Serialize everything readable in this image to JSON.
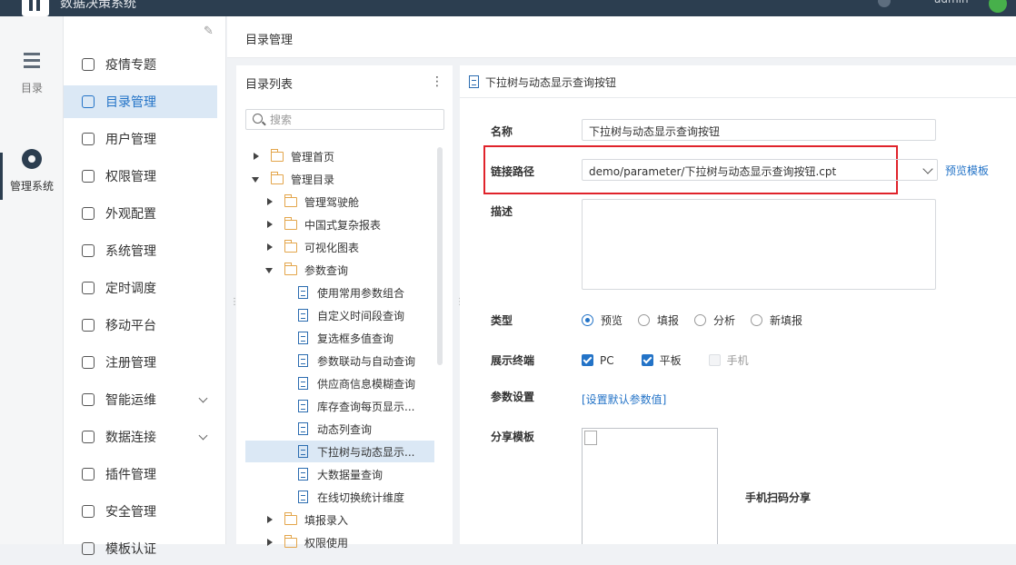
{
  "app": {
    "title": "数据决策系统",
    "user": "admin"
  },
  "rail": [
    {
      "label": "目录",
      "icon": "list-icon"
    },
    {
      "label": "管理系统",
      "icon": "gear-icon"
    }
  ],
  "sidebar": {
    "items": [
      {
        "label": "疫情专题",
        "icon": "monitor-icon"
      },
      {
        "label": "目录管理",
        "icon": "directory-icon",
        "active": true
      },
      {
        "label": "用户管理",
        "icon": "user-icon"
      },
      {
        "label": "权限管理",
        "icon": "lock-icon"
      },
      {
        "label": "外观配置",
        "icon": "brush-icon"
      },
      {
        "label": "系统管理",
        "icon": "settings-icon"
      },
      {
        "label": "定时调度",
        "icon": "timer-icon"
      },
      {
        "label": "移动平台",
        "icon": "mobile-icon"
      },
      {
        "label": "注册管理",
        "icon": "register-icon"
      },
      {
        "label": "智能运维",
        "icon": "network-icon",
        "expandable": true
      },
      {
        "label": "数据连接",
        "icon": "link-icon",
        "expandable": true
      },
      {
        "label": "插件管理",
        "icon": "puzzle-icon"
      },
      {
        "label": "安全管理",
        "icon": "shield-icon"
      },
      {
        "label": "模板认证",
        "icon": "template-icon"
      }
    ]
  },
  "main": {
    "title": "目录管理"
  },
  "tree": {
    "title": "目录列表",
    "search_placeholder": "搜索",
    "rows": [
      {
        "label": "管理首页",
        "level": 0,
        "type": "folder",
        "caret": "right"
      },
      {
        "label": "管理目录",
        "level": 0,
        "type": "folder",
        "caret": "down"
      },
      {
        "label": "管理驾驶舱",
        "level": 1,
        "type": "folder",
        "caret": "right"
      },
      {
        "label": "中国式复杂报表",
        "level": 1,
        "type": "folder",
        "caret": "right"
      },
      {
        "label": "可视化图表",
        "level": 1,
        "type": "folder",
        "caret": "right"
      },
      {
        "label": "参数查询",
        "level": 1,
        "type": "folder",
        "caret": "down"
      },
      {
        "label": "使用常用参数组合",
        "level": 2,
        "type": "doc"
      },
      {
        "label": "自定义时间段查询",
        "level": 2,
        "type": "doc"
      },
      {
        "label": "复选框多值查询",
        "level": 2,
        "type": "doc"
      },
      {
        "label": "参数联动与自动查询",
        "level": 2,
        "type": "doc"
      },
      {
        "label": "供应商信息模糊查询",
        "level": 2,
        "type": "doc"
      },
      {
        "label": "库存查询每页显示...",
        "level": 2,
        "type": "doc"
      },
      {
        "label": "动态列查询",
        "level": 2,
        "type": "doc"
      },
      {
        "label": "下拉树与动态显示...",
        "level": 2,
        "type": "doc",
        "selected": true
      },
      {
        "label": "大数据量查询",
        "level": 2,
        "type": "doc"
      },
      {
        "label": "在线切换统计维度",
        "level": 2,
        "type": "doc"
      },
      {
        "label": "填报录入",
        "level": 1,
        "type": "folder",
        "caret": "right"
      },
      {
        "label": "权限使用",
        "level": 1,
        "type": "folder",
        "caret": "right"
      }
    ]
  },
  "detail": {
    "header": "下拉树与动态显示查询按钮",
    "name_label": "名称",
    "name_value": "下拉树与动态显示查询按钮",
    "path_label": "链接路径",
    "path_value": "demo/parameter/下拉树与动态显示查询按钮.cpt",
    "preview_link": "预览模板",
    "desc_label": "描述",
    "type_label": "类型",
    "type_options": [
      {
        "label": "预览",
        "checked": true
      },
      {
        "label": "填报",
        "checked": false
      },
      {
        "label": "分析",
        "checked": false
      },
      {
        "label": "新填报",
        "checked": false
      }
    ],
    "terminal_label": "展示终端",
    "terminal_options": [
      {
        "label": "PC",
        "checked": true,
        "disabled": false
      },
      {
        "label": "平板",
        "checked": true,
        "disabled": false
      },
      {
        "label": "手机",
        "checked": false,
        "disabled": true
      }
    ],
    "param_label": "参数设置",
    "param_link": "[设置默认参数值]",
    "share_label": "分享模板",
    "qr_caption": "手机扫码分享"
  },
  "colors": {
    "accent": "#2373c7",
    "topbar": "#2c3e50",
    "highlight_box": "#e0232b",
    "selected_bg": "#dbe8f5"
  }
}
